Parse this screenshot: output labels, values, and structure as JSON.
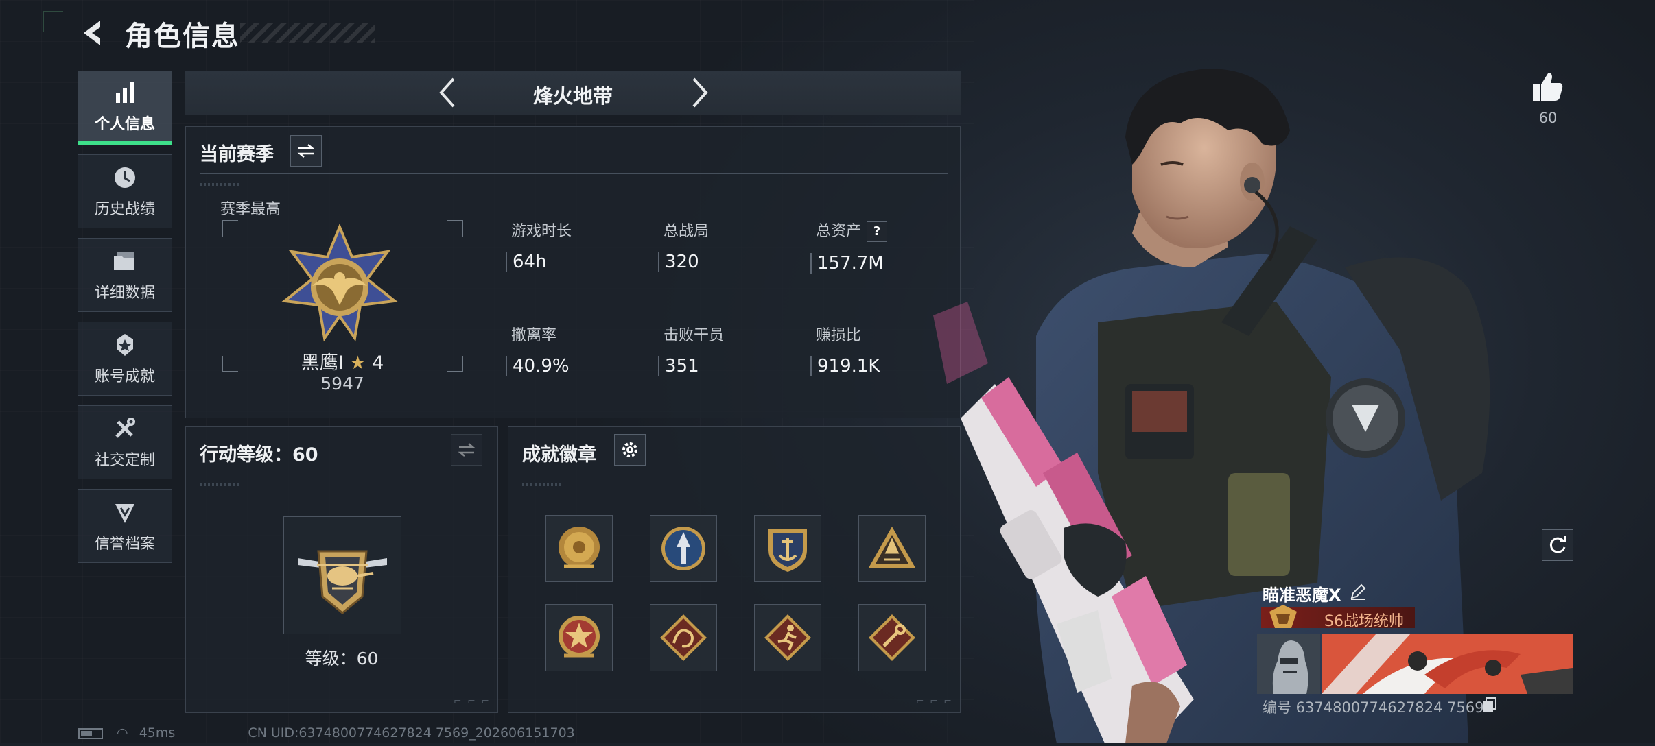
{
  "header": {
    "title": "角色信息"
  },
  "sidebar": {
    "items": [
      {
        "label": "个人信息",
        "icon": "bar-chart-icon",
        "active": true
      },
      {
        "label": "历史战绩",
        "icon": "history-icon"
      },
      {
        "label": "详细数据",
        "icon": "folder-icon"
      },
      {
        "label": "账号成就",
        "icon": "achievement-icon"
      },
      {
        "label": "社交定制",
        "icon": "tools-icon"
      },
      {
        "label": "信誉档案",
        "icon": "shield-arrow-icon"
      }
    ]
  },
  "mode": {
    "title": "烽火地带"
  },
  "season": {
    "title": "当前赛季",
    "best_label": "赛季最高",
    "rank_name": "黑鹰I",
    "rank_stars": "4",
    "rank_score": "5947",
    "stats": [
      {
        "label": "游戏时长",
        "value": "64h"
      },
      {
        "label": "总战局",
        "value": "320"
      },
      {
        "label": "总资产",
        "value": "157.7M",
        "help": "?"
      },
      {
        "label": "撤离率",
        "value": "40.9%"
      },
      {
        "label": "击败干员",
        "value": "351"
      },
      {
        "label": "赚损比",
        "value": "919.1K"
      }
    ]
  },
  "level": {
    "title": "行动等级：60",
    "text": "等级：60"
  },
  "achievements": {
    "title": "成就徽章",
    "badges": [
      "flower-badge-icon",
      "arrow-badge-icon",
      "anchor-shield-badge-icon",
      "pyramid-badge-icon",
      "star-badge-icon",
      "dragon-badge-icon",
      "runner-badge-icon",
      "wrench-badge-icon"
    ]
  },
  "social": {
    "likes": "60"
  },
  "player": {
    "name": "瞄准恶魔X",
    "title": "S6战场统帅",
    "id": "编号 6374800774627824 7569"
  },
  "footer": {
    "ping": "45ms",
    "uid": "CN UID:6374800774627824 7569_202606151703"
  },
  "colors": {
    "accent": "#3ee08a",
    "title_bar": "#7a1f1a"
  }
}
